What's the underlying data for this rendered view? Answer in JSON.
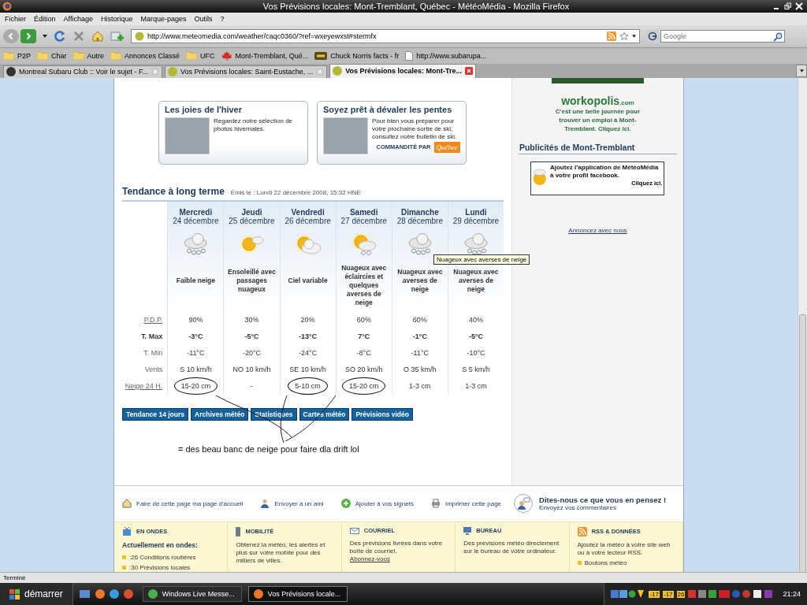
{
  "window": {
    "title": "Vos Prévisions locales: Mont-Tremblant, Québec - MétéoMédia - Mozilla Firefox"
  },
  "menu": [
    "Fichier",
    "Édition",
    "Affichage",
    "Historique",
    "Marque-pages",
    "Outils",
    "?"
  ],
  "toolbar": {
    "url": "http://www.meteomedia.com/weather/caqc0360/?ref=wxeyewxst#stermfx",
    "search_placeholder": "Google"
  },
  "bookmarks": [
    {
      "label": "P2P",
      "kind": "folder"
    },
    {
      "label": "Char",
      "kind": "folder"
    },
    {
      "label": "Autre",
      "kind": "folder"
    },
    {
      "label": "Annonces Classé",
      "kind": "folder"
    },
    {
      "label": "UFC",
      "kind": "folder"
    },
    {
      "label": "Mont-Tremblant, Qué...",
      "kind": "leaf"
    },
    {
      "label": "Chuck Norris facts - fr",
      "kind": "badge"
    },
    {
      "label": "http://www.subarupa...",
      "kind": "page"
    }
  ],
  "tabs": [
    {
      "label": "Montreal Subaru Club :: Voir le sujet - F...",
      "selected": false
    },
    {
      "label": "Vos Prévisions locales: Saint-Eustache, ...",
      "selected": false
    },
    {
      "label": "Vos Prévisions locales: Mont-Tre...",
      "selected": true
    }
  ],
  "promos": [
    {
      "title": "Les joies de l'hiver",
      "text": "Regardez notre sélection de photos hivernales."
    },
    {
      "title": "Soyez prêt à dévaler les pentes",
      "text": "Pour bien vous préparer pour votre prochaine sortie de ski, consultez notre bulletin de ski.",
      "sponsor": "COMMANDITÉ PAR",
      "sponsor_logo": "Québec"
    }
  ],
  "forecast": {
    "title": "Tendance à long terme",
    "issued": "Émis le : Lundi 22 décembre 2008, 15:32 HNE",
    "days": [
      {
        "day": "Mercredi",
        "date": "24 décembre",
        "kind": "snow",
        "condition": "Faible neige"
      },
      {
        "day": "Jeudi",
        "date": "25 décembre",
        "kind": "sunny",
        "condition": "Ensoleillé avec passages nuageux"
      },
      {
        "day": "Vendredi",
        "date": "26 décembre",
        "kind": "cloudy",
        "condition": "Ciel variable"
      },
      {
        "day": "Samedi",
        "date": "27 décembre",
        "kind": "mixed",
        "condition": "Nuageux avec éclaircies et quelques averses de neige"
      },
      {
        "day": "Dimanche",
        "date": "28 décembre",
        "kind": "snow",
        "condition": "Nuageux avec averses de neige"
      },
      {
        "day": "Lundi",
        "date": "29 décembre",
        "kind": "snow",
        "condition": "Nuageux avec averses de neige"
      }
    ],
    "rows": [
      {
        "label": "P.D.P.",
        "kind": "link",
        "cells": [
          {
            "text": "90%",
            "circled": false
          },
          {
            "text": "30%",
            "circled": false
          },
          {
            "text": "20%",
            "circled": false
          },
          {
            "text": "60%",
            "circled": false
          },
          {
            "text": "60%",
            "circled": false
          },
          {
            "text": "40%",
            "circled": false
          }
        ]
      },
      {
        "label": "T. Max",
        "kind": "bold",
        "cells": [
          {
            "text": "-3°C",
            "circled": false
          },
          {
            "text": "-5°C",
            "circled": false
          },
          {
            "text": "-13°C",
            "circled": false
          },
          {
            "text": "7°C",
            "circled": false
          },
          {
            "text": "-1°C",
            "circled": false
          },
          {
            "text": "-5°C",
            "circled": false
          }
        ]
      },
      {
        "label": "T. Min",
        "kind": "plain",
        "cells": [
          {
            "text": "-11°C",
            "circled": false
          },
          {
            "text": "-20°C",
            "circled": false
          },
          {
            "text": "-24°C",
            "circled": false
          },
          {
            "text": "-8°C",
            "circled": false
          },
          {
            "text": "-11°C",
            "circled": false
          },
          {
            "text": "-10°C",
            "circled": false
          }
        ]
      },
      {
        "label": "Vents",
        "kind": "plain",
        "cells": [
          {
            "text": "S 10 km/h",
            "circled": false
          },
          {
            "text": "NO 10 km/h",
            "circled": false
          },
          {
            "text": "SE 10 km/h",
            "circled": false
          },
          {
            "text": "SO 20 km/h",
            "circled": false
          },
          {
            "text": "O 35 km/h",
            "circled": false
          },
          {
            "text": "S 5 km/h",
            "circled": false
          }
        ]
      },
      {
        "label": "Neige 24 H.",
        "kind": "link",
        "cells": [
          {
            "text": "15-20 cm",
            "circled": true
          },
          {
            "text": "-",
            "circled": false
          },
          {
            "text": "5-10 cm",
            "circled": true
          },
          {
            "text": "15-20 cm",
            "circled": true
          },
          {
            "text": "1-3 cm",
            "circled": false
          },
          {
            "text": "1-3 cm",
            "circled": false
          }
        ]
      }
    ],
    "tooltip": "Nuageux avec averses de neige"
  },
  "section_buttons": [
    "Tendance 14 jours",
    "Archives météo",
    "Statistiques",
    "Cartes météo",
    "Prévisions vidéo"
  ],
  "annotation": "= des beau banc de neige pour faire dla drift lol",
  "sidebar": {
    "logo": "workopolis",
    "logo_suffix": ".com",
    "job_text": "C'est une belle journée pour trouver un emploi à Mont-Tremblant. Cliquez ici.",
    "ads_title": "Publicités de Mont-Tremblant",
    "ad_text": "Ajoutez l’application de MétéoMédia à votre profil **facebook**.",
    "ad_cta": "Cliquez ici.",
    "advertise_link": "Annoncez avec nous"
  },
  "page_links": [
    {
      "label": "Faire de cette page ma page d'accueil",
      "kind": "house"
    },
    {
      "label": "Envoyer à un ami",
      "kind": "person"
    },
    {
      "label": "Ajouter à vos signets",
      "kind": "plus"
    },
    {
      "label": "Imprimer cette page",
      "kind": "printer"
    }
  ],
  "feedback": {
    "title": "Dites-nous ce que vous en pensez !",
    "subtitle": "Envoyez vos commentaires"
  },
  "footer_columns": [
    {
      "title": "EN ONDES",
      "kind": "tv",
      "subtitle": "Actuellement en ondes:",
      "items": [
        ":26 Conditions routières",
        ":30 Prévisions locales"
      ]
    },
    {
      "title": "MOBILITÉ",
      "kind": "phone",
      "text": "Obtenez la météo, les alertes et plus sur votre mobile pour des milliers de villes."
    },
    {
      "title": "COURRIEL",
      "kind": "envelope",
      "text": "Des prévisions livrées dans votre boîte de courriel.",
      "link": "Abonnez-vous"
    },
    {
      "title": "BUREAU",
      "kind": "monitor",
      "text": "Des prévisions météo directement sur le bureau de votre ordinateur."
    },
    {
      "title": "RSS & DONNÉES",
      "kind": "rss",
      "text": "Ajoutez la météo à votre site web ou à votre lecteur RSS.",
      "items": [
        "Boutons météo"
      ]
    }
  ],
  "status": "Terminé",
  "taskbar": {
    "start": "démarrer",
    "tasks": [
      {
        "label": "Windows Live Messe...",
        "selected": false
      },
      {
        "label": "Vos Prévisions locale...",
        "selected": true
      }
    ],
    "tray_temps": [
      "-17",
      "-17",
      "26"
    ],
    "clock": "21:24"
  }
}
